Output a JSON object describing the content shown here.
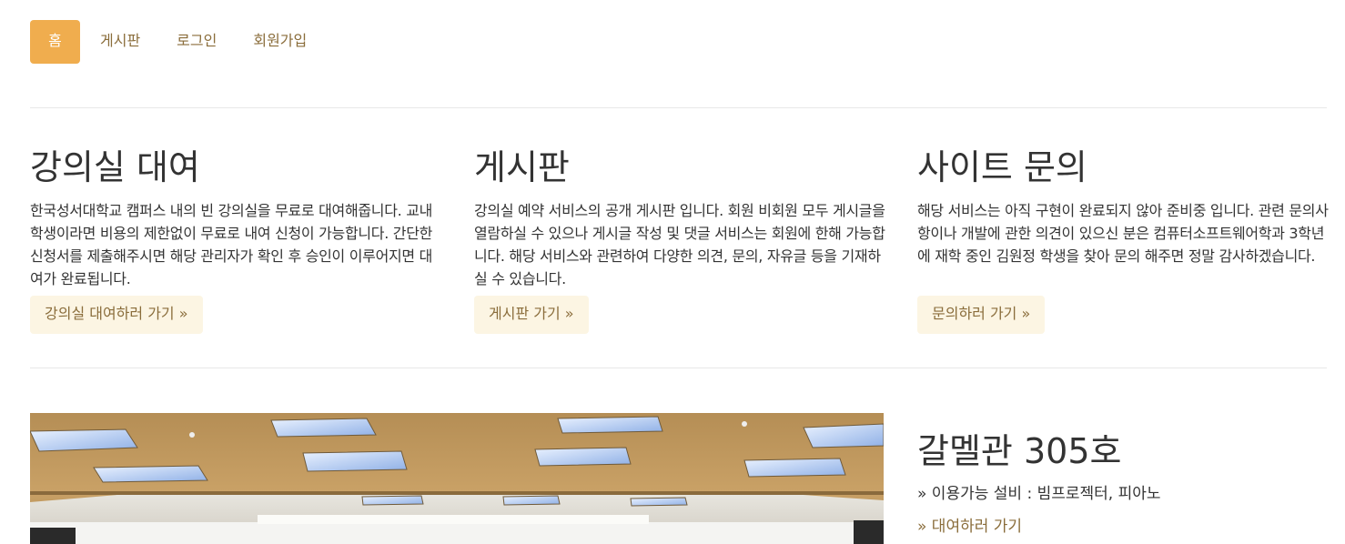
{
  "nav": {
    "items": [
      {
        "label": "홈",
        "active": true
      },
      {
        "label": "게시판",
        "active": false
      },
      {
        "label": "로그인",
        "active": false
      },
      {
        "label": "회원가입",
        "active": false
      }
    ]
  },
  "columns": [
    {
      "title": "강의실 대여",
      "body": "한국성서대학교 캠퍼스 내의 빈 강의실을 무료로 대여해줍니다. 교내 학생이라면 비용의 제한없이 무료로 내여 신청이 가능합니다. 간단한 신청서를 제출해주시면 해당 관리자가 확인 후 승인이 이루어지면 대여가 완료됩니다.",
      "button": "강의실 대여하러 가기 »"
    },
    {
      "title": "게시판",
      "body": "강의실 예약 서비스의 공개 게시판 입니다. 회원 비회원 모두 게시글을 열람하실 수 있으나 게시글 작성 및 댓글 서비스는 회원에 한해 가능합니다. 해당 서비스와 관련하여 다양한 의견, 문의, 자유글 등을 기재하실 수 있습니다.",
      "button": "게시판 가기 »"
    },
    {
      "title": "사이트 문의",
      "body": "해당 서비스는 아직 구현이 완료되지 않아 준비중 입니다. 관련 문의사항이나 개발에 관한 의견이 있으신 분은 컴퓨터소프트웨어학과 3학년에 재학 중인 김원정 학생을 찾아 문의 해주면 정말 감사하겠습니다.",
      "button": "문의하러 가기 »"
    }
  ],
  "feature": {
    "title": "갈멜관 305호",
    "equipment": "» 이용가능 설비 : 빔프로젝터, 피아노",
    "link": "» 대여하러 가기"
  },
  "colors": {
    "accent": "#f0ad4e",
    "link": "#8a6d3b",
    "button_bg": "#fcf5e3"
  }
}
